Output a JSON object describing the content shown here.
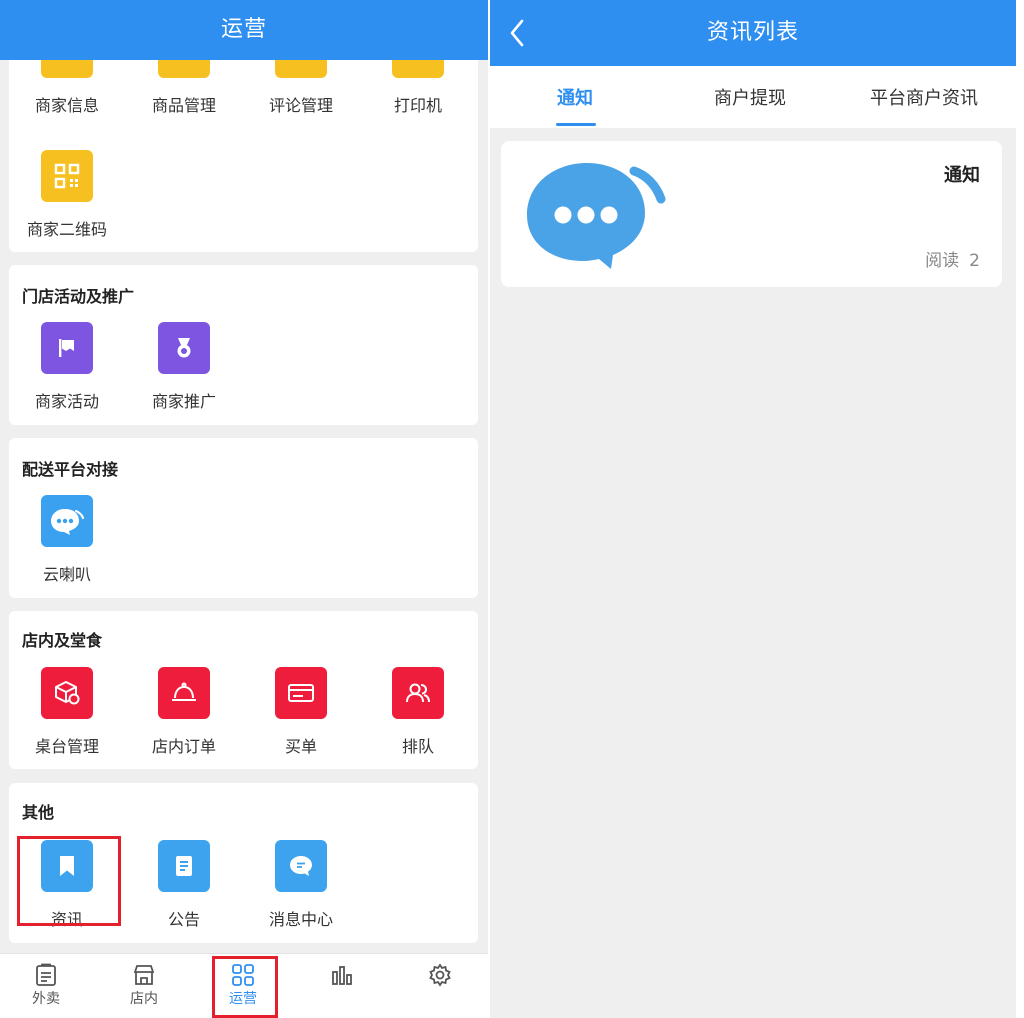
{
  "left": {
    "title": "运营",
    "top_items": [
      "商家信息",
      "商品管理",
      "评论管理",
      "打印机"
    ],
    "qr_item": "商家二维码",
    "sections": {
      "promo": {
        "title": "门店活动及推广",
        "items": [
          "商家活动",
          "商家推广"
        ]
      },
      "delivery": {
        "title": "配送平台对接",
        "items": [
          "云喇叭"
        ]
      },
      "dinein": {
        "title": "店内及堂食",
        "items": [
          "桌台管理",
          "店内订单",
          "买单",
          "排队"
        ]
      },
      "other": {
        "title": "其他",
        "items": [
          "资讯",
          "公告",
          "消息中心"
        ]
      }
    },
    "bottom_tabs": [
      "外卖",
      "店内",
      "运营"
    ],
    "active_tab": "运营",
    "colors": {
      "accent": "#2f8ff0",
      "highlight": "#e3202b"
    }
  },
  "right": {
    "title": "资讯列表",
    "tabs": [
      "通知",
      "商户提现",
      "平台商户资讯"
    ],
    "active_tab": "通知",
    "news": {
      "title": "通知",
      "read_label": "阅读",
      "read_count": "2"
    }
  }
}
